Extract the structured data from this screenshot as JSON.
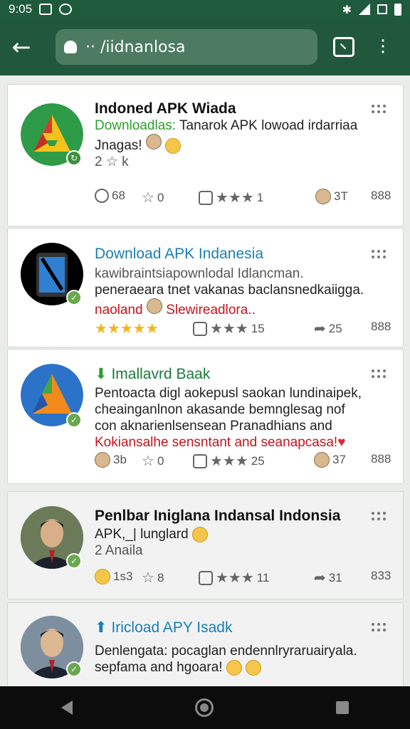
{
  "status_bar": {
    "time": "9:05"
  },
  "address_bar": {
    "url": "·· /iidnanlosa"
  },
  "posts": [
    {
      "title": "Indoned APK Wiada",
      "line1_green": "Downloadlas:",
      "line1_rest": " Tanarok APK lowoad irdarriaa",
      "line2": "Jnagas!",
      "line3": "2 ☆ k",
      "stats": {
        "shares": "68",
        "likes": "0",
        "stars": "1",
        "views": "3T",
        "total": "888"
      }
    },
    {
      "title": "Download APK Indanesia",
      "line1": "kawibraintsiapownlodal Idlancman.",
      "line2": "peneraeara tnet vakanas baclansnedkaiigga.",
      "line3_red": "naoland",
      "line3_red2": "Slewireadlora..",
      "stats": {
        "stars": "15",
        "shares": "25",
        "total": "888"
      }
    },
    {
      "title": "Imallavrd Baak",
      "line1": "Pentoacta digl aokepusl saokan lundinaipek,",
      "line2": "cheainganlnon akasande bemnglesag nof",
      "line3": "con aknarienlsensean Pranadhians and",
      "line4_red": "Kokiansalhe sensntant and seanapcasa!",
      "stats": {
        "comments": "3b",
        "likes": "0",
        "stars": "25",
        "views": "37",
        "total": "888"
      }
    },
    {
      "title": "Penlbar Iniglana Indansal Indonsia",
      "line1": "APK,_| lunglard",
      "line2": "2 Anaila",
      "stats": {
        "comments": "1s3",
        "likes": "8",
        "stars": "11",
        "shares": "31",
        "total": "833"
      }
    },
    {
      "title": "Iricload APY Isadk",
      "line1": "Denlengata: pocaglan endennlryraruairyala.",
      "line2": "sepfama and hgoara!"
    }
  ]
}
